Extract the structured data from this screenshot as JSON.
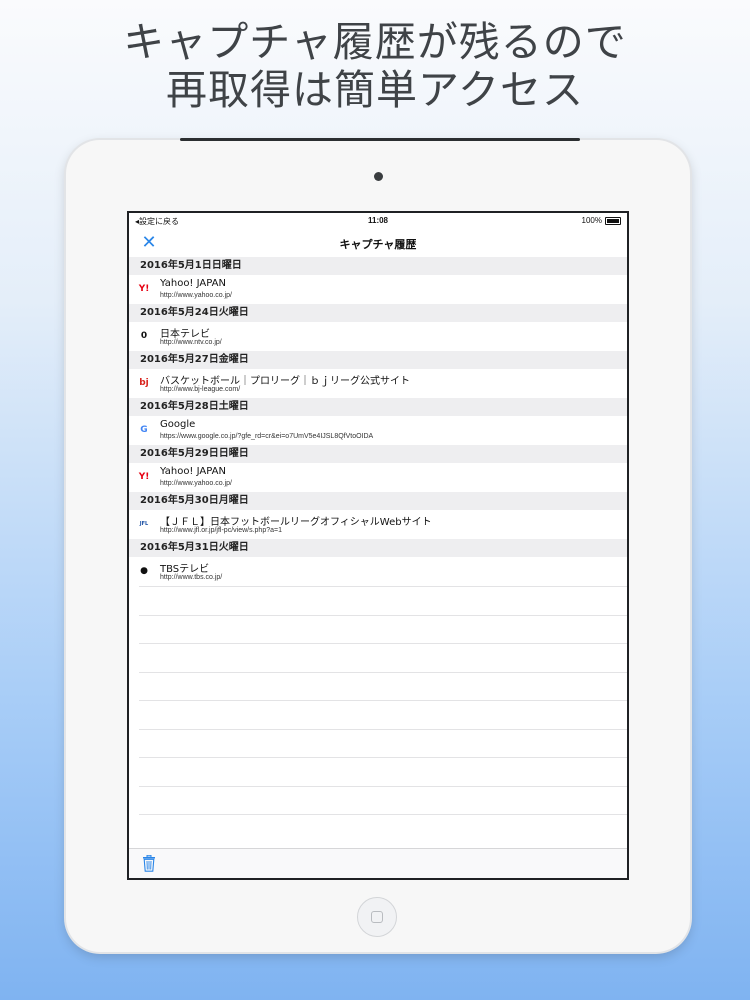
{
  "headline": {
    "line1": "キャプチャ履歴が残るので",
    "line2": "再取得は簡単アクセス"
  },
  "status_bar": {
    "back_label": "◂設定に戻る",
    "time": "11:08",
    "battery": "100%"
  },
  "nav": {
    "close_icon": "close-icon",
    "title": "キャプチャ履歴"
  },
  "history": [
    {
      "date": "2016年5月1日日曜日",
      "title": "Yahoo! JAPAN",
      "url": "http://www.yahoo.co.jp/",
      "favicon": "Y!",
      "favicon_color": "#e60012"
    },
    {
      "date": "2016年5月24日火曜日",
      "title": "日本テレビ",
      "url": "http://www.ntv.co.jp/",
      "favicon": "0",
      "favicon_color": "#111111"
    },
    {
      "date": "2016年5月27日金曜日",
      "title": "バスケットボール｜プロリーグ｜ｂｊリーグ公式サイト",
      "url": "http://www.bj-league.com/",
      "favicon": "bj",
      "favicon_color": "#d9231d"
    },
    {
      "date": "2016年5月28日土曜日",
      "title": "Google",
      "url": "https://www.google.co.jp/?gfe_rd=cr&ei=o7UmV5e4IJSL8QfVtoOIDA",
      "favicon": "G",
      "favicon_color": "#4285f4"
    },
    {
      "date": "2016年5月29日日曜日",
      "title": "Yahoo! JAPAN",
      "url": "http://www.yahoo.co.jp/",
      "favicon": "Y!",
      "favicon_color": "#e60012"
    },
    {
      "date": "2016年5月30日月曜日",
      "title": "【ＪＦＬ】日本フットボールリーグオフィシャルWebサイト",
      "url": "http://www.jfl.or.jp/jfl-pc/view/s.php?a=1",
      "favicon": "JFL",
      "favicon_color": "#1a4fa3"
    },
    {
      "date": "2016年5月31日火曜日",
      "title": "TBSテレビ",
      "url": "http://www.tbs.co.jp/",
      "favicon": "●",
      "favicon_color": "#111111"
    }
  ],
  "toolbar": {
    "trash_icon": "trash-icon"
  },
  "colors": {
    "accent": "#2a86e8",
    "section_bg": "#eeeef0"
  }
}
